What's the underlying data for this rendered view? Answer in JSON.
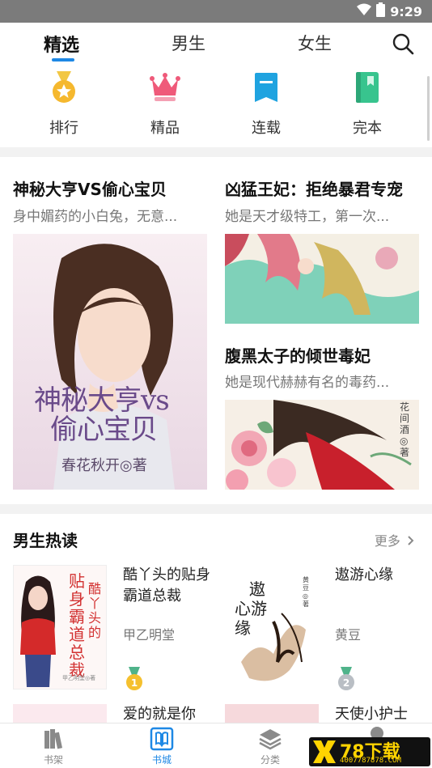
{
  "status": {
    "time": "9:29",
    "wifi_icon": "wifi-icon",
    "battery_icon": "battery-icon"
  },
  "tabs": [
    {
      "label": "精选",
      "active": true
    },
    {
      "label": "男生",
      "active": false
    },
    {
      "label": "女生",
      "active": false
    }
  ],
  "quick_nav": [
    {
      "label": "排行",
      "icon": "medal-icon",
      "color": "#f5b82e"
    },
    {
      "label": "精品",
      "icon": "crown-icon",
      "color": "#ef5a7a"
    },
    {
      "label": "连载",
      "icon": "bookmark-icon",
      "color": "#1fa3e0"
    },
    {
      "label": "完本",
      "icon": "book-icon",
      "color": "#38c48e"
    }
  ],
  "featured": [
    {
      "title": "神秘大亨VS偷心宝贝",
      "desc": "身中媚药的小白兔，无意...",
      "cover_title_line1": "神秘大亨vs",
      "cover_title_line2": "偷心宝贝",
      "cover_author": "春花秋开◎著"
    },
    {
      "title": "凶猛王妃：拒绝暴君专宠",
      "desc": "她是天才级特工，第一次..."
    },
    {
      "title": "腹黑太子的倾世毒妃",
      "desc": "她是现代赫赫有名的毒药...",
      "cover_author": "花间酒◎著"
    }
  ],
  "section": {
    "title": "男生热读",
    "more": "更多"
  },
  "books": [
    {
      "title": "酷丫头的贴身霸道总裁",
      "author": "甲乙明堂",
      "rank": "1",
      "cover_text1": "贴身霸道总裁",
      "cover_text2": "酷丫头的",
      "cover_author": "甲乙明堂◎著"
    },
    {
      "title": "遨游心缘",
      "author": "黄豆",
      "rank": "2",
      "cover_text1": "遨",
      "cover_text2": "心游",
      "cover_text3": "缘",
      "cover_author": "黄豆◎著"
    },
    {
      "title": "爱的就是你"
    },
    {
      "title": "天使小护士"
    }
  ],
  "bottom_nav": [
    {
      "label": "书架",
      "icon": "bookshelf-icon",
      "active": false
    },
    {
      "label": "书城",
      "icon": "store-icon",
      "active": true
    },
    {
      "label": "分类",
      "icon": "layers-icon",
      "active": false
    }
  ],
  "watermark": {
    "main": "78下载",
    "sub": "4007787878.COM"
  }
}
